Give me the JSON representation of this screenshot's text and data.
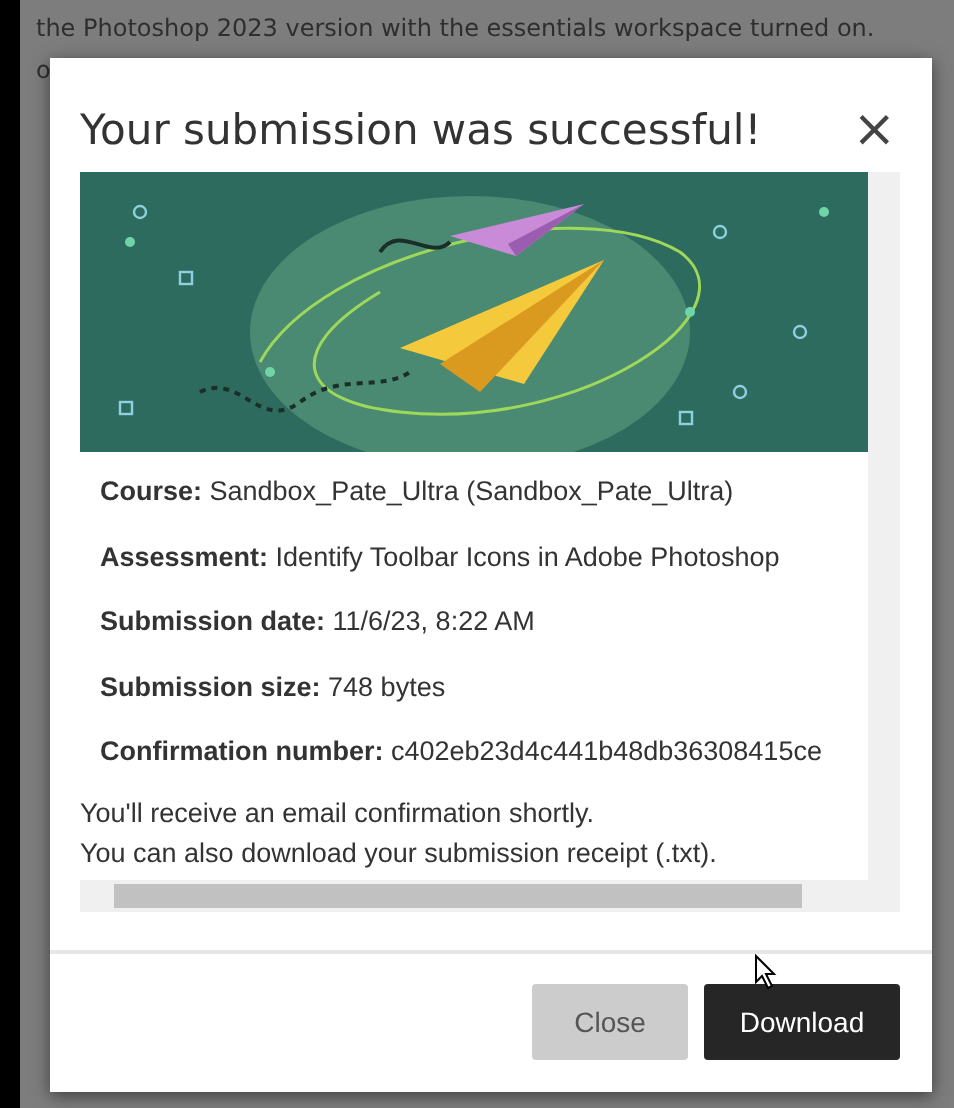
{
  "background": {
    "text_lines": [
      "the Photoshop 2023 version with the essentials workspace turned on.",
      "o"
    ]
  },
  "dialog": {
    "title": "Your submission was successful!",
    "close_icon": "×",
    "details": [
      {
        "label": "Course:",
        "value": "Sandbox_Pate_Ultra (Sandbox_Pate_Ultra)"
      },
      {
        "label": "Assessment:",
        "value": "Identify Toolbar Icons in Adobe Photoshop"
      },
      {
        "label": "Submission date:",
        "value": "11/6/23, 8:22 AM"
      },
      {
        "label": "Submission size:",
        "value": "748 bytes"
      },
      {
        "label": "Confirmation number:",
        "value": "c402eb23d4c441b48db36308415ce"
      }
    ],
    "notes": [
      "You'll receive an email confirmation shortly.",
      "You can also download your submission receipt (.txt)."
    ],
    "buttons": [
      {
        "label": "Close",
        "kind": "secondary"
      },
      {
        "label": "Download",
        "kind": "primary"
      }
    ]
  }
}
